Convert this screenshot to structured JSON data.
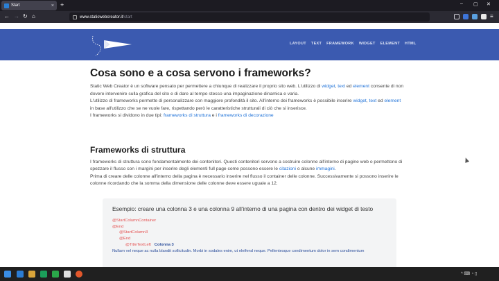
{
  "browser": {
    "tab_title": "Start",
    "tab_close": "×",
    "new_tab": "+",
    "url_host": "www.staticwebcreator.it",
    "url_path": "/start",
    "window_controls": [
      "–",
      "▢",
      "✕"
    ]
  },
  "site": {
    "menu": [
      "LAYOUT",
      "TEXT",
      "FRAMEWORK",
      "WIDGET",
      "ELEMENT",
      "HTML"
    ],
    "header_color": "#3b5ab0"
  },
  "article": {
    "h1": "Cosa sono e a cosa servono i frameworks?",
    "p1_a": "Static Web Creator è un software pensato per permettere a chiunque di realizzare il proprio sito web. L'utilizzo di ",
    "p1_link1": "widget",
    "p1_b": ", ",
    "p1_link2": "text",
    "p1_c": " ed ",
    "p1_link3": "element",
    "p1_d": " consente di non dovere intervenire sulla grafica del sito e di dare al tempo stesso una impaginazione dinamica e varia.",
    "p2_a": "L'utilizzo di frameworks permette di personalizzare con maggiore profondità il sito. All'interno dei frameworks è possibile inserire ",
    "p2_link1": "widget",
    "p2_b": ", ",
    "p2_link2": "text",
    "p2_c": " ed ",
    "p2_link3": "element",
    "p2_d": " in base all'utilizzo che se ne vuole fare, rispettando però le caratteristiche strutturali di ciò che si inserisce.",
    "p3_a": "I frameworks si dividono in due tipi: ",
    "p3_link1": "frameworks di struttura",
    "p3_b": " e i ",
    "p3_link2": "frameworks di decorazione",
    "h2": "Frameworks di struttura",
    "p4_a": "I frameworks di struttura sono fondamentalmente dei contenitori. Questi contenitori servono a costruire colonne all'interno di pagine web o permettono di spezzare il flusso con i margini per inserire degli elementi full page come possono essere le ",
    "p4_link1": "citazioni",
    "p4_b": " o alcune ",
    "p4_link2": "immagini",
    "p4_c": ".",
    "p5": "Prima di creare delle colonne all'interno della pagina è necessario inserire nel flusso il container delle colonne. Successivamente si possono inserire le colonne ricordando che la somma della dimensione delle colonne deve essere uguale a 12."
  },
  "example": {
    "title": "Esempio: creare una colonna 3 e una colonna 9 all'interno di una pagina con dentro dei widget di testo",
    "line1": "@StartColumnContainer",
    "line2": "@End",
    "line3": "@StartColumn3",
    "line4": "@End",
    "line5_tag": "@TitleTextLeft",
    "line5_val": "Colonna 3",
    "line6": "Nullam vel neque ac nulla blandit sollicitudin. Morbi in sodales enim, ut eleifend neque. Pellentesque condimentum dolor in sem condimentum"
  },
  "taskbar": {
    "tray_text": "^  ⌨  ◔  ▯"
  }
}
